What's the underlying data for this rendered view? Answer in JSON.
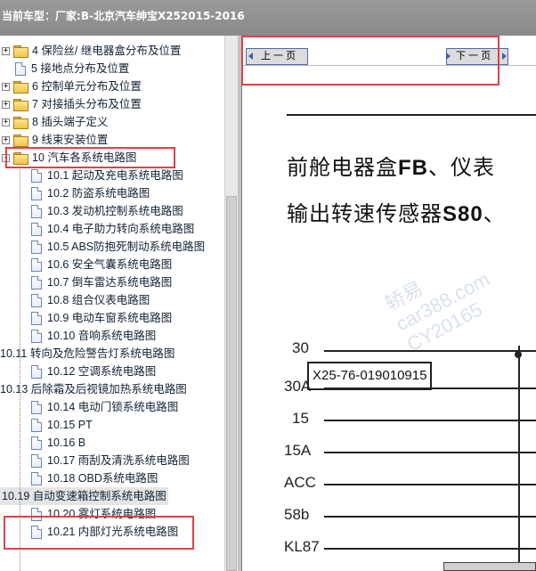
{
  "title_bar": {
    "prefix": "当前车型：",
    "vehicle": "厂家:B-北京汽车绅宝X252015-2016"
  },
  "tree": {
    "items": [
      {
        "kind": "folder",
        "label": "4 保险丝/ 继电器盒分布及位置",
        "expander": "+"
      },
      {
        "kind": "doc",
        "label": "5 接地点分布及位置"
      },
      {
        "kind": "folder",
        "label": "6 控制单元分布及位置",
        "expander": "+"
      },
      {
        "kind": "folder",
        "label": "7 对接插头分布及位置",
        "expander": "+"
      },
      {
        "kind": "folder",
        "label": "8 插头端子定义",
        "expander": "+"
      },
      {
        "kind": "folder",
        "label": "9 线束安装位置",
        "expander": "+"
      },
      {
        "kind": "folder",
        "label": "10 汽车各系统电路图",
        "expander": "-"
      },
      {
        "kind": "doc",
        "label": "10.1 起动及充电系统电路图"
      },
      {
        "kind": "doc",
        "label": "10.2 防盗系统电路图"
      },
      {
        "kind": "doc",
        "label": "10.3 发动机控制系统电路图"
      },
      {
        "kind": "doc",
        "label": "10.4 电子助力转向系统电路图"
      },
      {
        "kind": "doc",
        "label": "10.5 ABS防抱死制动系统电路图"
      },
      {
        "kind": "doc",
        "label": "10.6 安全气囊系统电路图"
      },
      {
        "kind": "doc",
        "label": "10.7 倒车雷达系统电路图"
      },
      {
        "kind": "doc",
        "label": "10.8 组合仪表电路图"
      },
      {
        "kind": "doc",
        "label": "10.9 电动车窗系统电路图"
      },
      {
        "kind": "doc",
        "label": "10.10 音响系统电路图"
      },
      {
        "kind": "text",
        "label": "10.11 转向及危险警告灯系统电路图"
      },
      {
        "kind": "doc",
        "label": "10.12 空调系统电路图"
      },
      {
        "kind": "text",
        "label": "10.13 后除霜及后视镜加热系统电路图"
      },
      {
        "kind": "doc",
        "label": "10.14 电动门锁系统电路图"
      },
      {
        "kind": "doc",
        "label": "10.15 PT"
      },
      {
        "kind": "doc",
        "label": "10.16 B"
      },
      {
        "kind": "doc",
        "label": "10.17 雨刮及清洗系统电路图"
      },
      {
        "kind": "doc",
        "label": "10.18 OBD系统电路图"
      },
      {
        "kind": "text",
        "label": "10.19 自动变速箱控制系统电路图",
        "selected": true
      },
      {
        "kind": "doc",
        "label": "10.20 雾灯系统电路图"
      },
      {
        "kind": "doc",
        "label": "10.21 内部灯光系统电路图"
      }
    ]
  },
  "nav": {
    "prev_label": "上 一 页",
    "next_label": "下 一 页"
  },
  "document": {
    "heading_line1_prefix": "前舱电器盒",
    "heading_line1_bold": "FB",
    "heading_line1_suffix": "、仪表",
    "heading_line2_prefix": "输出转速传感器",
    "heading_line2_bold": "S80",
    "heading_line2_suffix": "、",
    "connector_code": "X25-76-019010915",
    "pins": [
      "30",
      "30A",
      "15",
      "15A",
      "ACC",
      "58b",
      "KL87"
    ],
    "watermark_lines": [
      "轿易",
      "car388.com",
      "CY20165"
    ]
  },
  "colors": {
    "highlight_box": "#e0404a",
    "title_bar": "#8f8f8f",
    "nav_button": "#dcdcdc"
  }
}
